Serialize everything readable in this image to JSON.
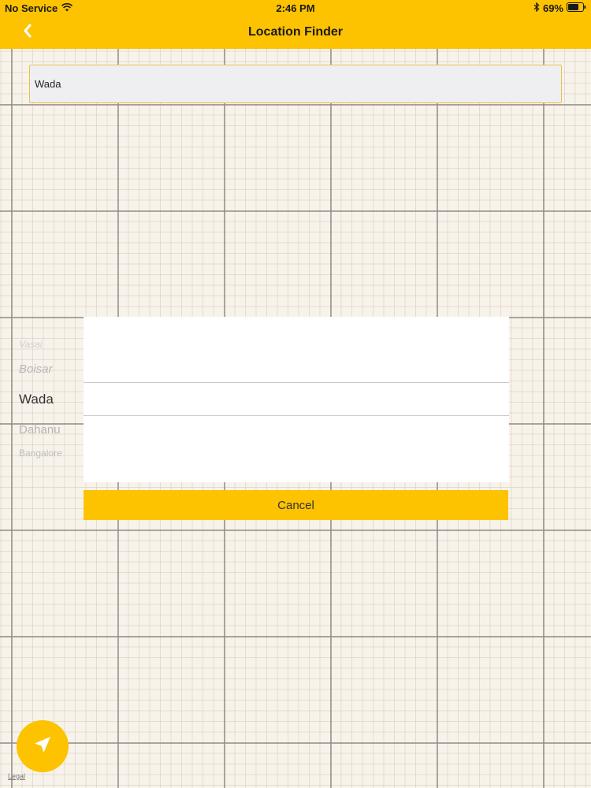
{
  "status_bar": {
    "carrier": "No Service",
    "time": "2:46 PM",
    "battery": "69%",
    "icons": [
      "wifi-icon",
      "bluetooth-icon",
      "battery-icon"
    ]
  },
  "nav": {
    "back_icon": "chevron-left-icon",
    "title": "Location Finder"
  },
  "search": {
    "value": "Wada"
  },
  "picker": {
    "items": [
      "Vasai",
      "Boisar",
      "Wada",
      "Dahanu",
      "Bangalore"
    ],
    "selected": "Wada"
  },
  "cancel_label": "Cancel",
  "locate_icon": "navigation-arrow-icon",
  "legal_label": "Legal",
  "colors": {
    "accent": "#fdc200",
    "search_border": "#e9c24a",
    "search_bg": "#efeff1",
    "grid_background": "#f8f3ea"
  }
}
